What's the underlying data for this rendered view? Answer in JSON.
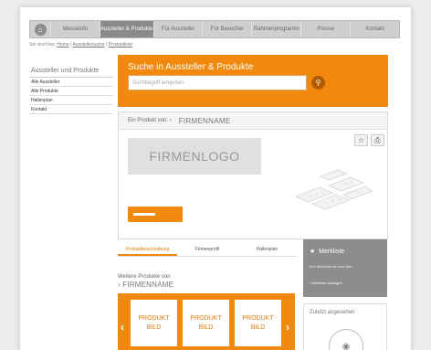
{
  "nav": {
    "items": [
      {
        "label": "Messeinfo"
      },
      {
        "label": "Aussteller & Produkte"
      },
      {
        "label": "Für Aussteller"
      },
      {
        "label": "Für Besucher"
      },
      {
        "label": "Rahmenprogramm"
      },
      {
        "label": "Presse"
      },
      {
        "label": "Kontakt"
      }
    ],
    "active_index": 1
  },
  "breadcrumb": {
    "prefix": "Sie sind hier:",
    "home": "Home",
    "sep1": "|",
    "item1": "Ausstellersuche",
    "sep2": "|",
    "item2": "Produktliste"
  },
  "sidebar": {
    "heading": "Aussteller und Produkte",
    "items": [
      {
        "label": "Alle Aussteller"
      },
      {
        "label": "Alle Produkte"
      },
      {
        "label": "Hallenplan"
      },
      {
        "label": "Kontakt"
      }
    ]
  },
  "search": {
    "title": "Suche in Aussteller & Produkte",
    "placeholder": "Suchbegriff eingeben",
    "button_icon": "search-icon"
  },
  "product": {
    "from_label": "Ein Produkt von: ›",
    "company": "FIRMENNAME",
    "logo_text": "FIRMENLOGO",
    "icons": [
      "favorite-star-icon",
      "print-icon"
    ]
  },
  "tabs": [
    {
      "label": "Produktbeschreibung",
      "active": true
    },
    {
      "label": "Firmenprofil",
      "active": false
    },
    {
      "label": "Hallenplan",
      "active": false
    }
  ],
  "more_products": {
    "label": "Weitere Produkte von",
    "company": "› FIRMENNAME",
    "cards": [
      {
        "label": "PRODUKT\nBILD"
      },
      {
        "label": "PRODUKT\nBILD"
      },
      {
        "label": "PRODUKT\nBILD"
      }
    ],
    "prev_icon": "‹",
    "next_icon": "›"
  },
  "merkliste": {
    "star": "★",
    "title": "Merkliste",
    "subtitle": "Ihre Merkliste ist noch leer.",
    "link": "› Merkliste anzeigen"
  },
  "recent": {
    "title": "Zuletzt angesehen",
    "icon": "camera-icon"
  },
  "colors": {
    "accent": "#f0890d",
    "nav_bg": "#cfcfcf",
    "nav_active": "#8a8a8a",
    "merkliste_bg": "#8d8d8d"
  }
}
